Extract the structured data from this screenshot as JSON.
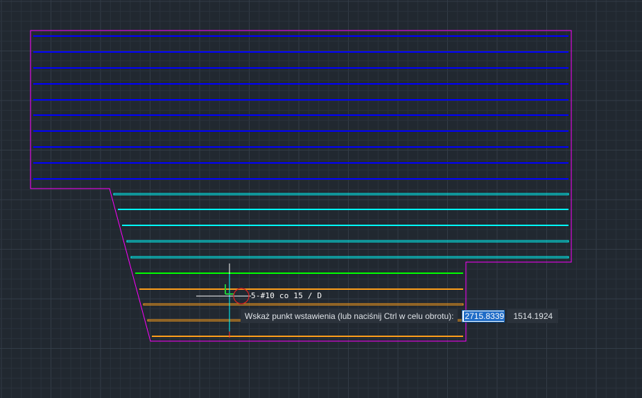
{
  "canvas": {
    "background": "#212830",
    "grid_minor": "#2a323c",
    "grid_major": "#333c47",
    "outline_color": "#ff00ff",
    "rebar_blue": "#0000ff",
    "rebar_cyan": "#00ffff",
    "rebar_green": "#00ff00",
    "rebar_orange": "#ff9f1a"
  },
  "preview_label": {
    "text": "5-#10 co 15 / D",
    "color": "#ffffff"
  },
  "crosshair": {
    "color_vertical": "#00ffff",
    "color_horizontal": "#ffffff",
    "ucs_icon": "ucs-axis-icon",
    "snap_marker": "circle-snap-icon"
  },
  "dynamic_input": {
    "prompt": "Wskaż punkt wstawienia (lub naciśnij Ctrl w celu obrotu):",
    "x_value": "2715.8339",
    "y_value": "1514.1924"
  }
}
